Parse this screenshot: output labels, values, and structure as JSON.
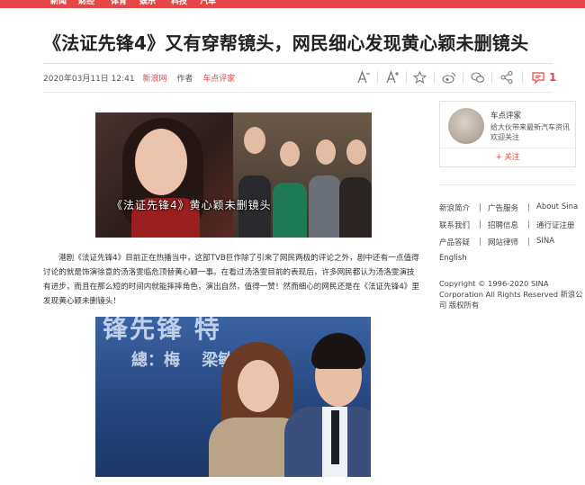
{
  "nav": {
    "items": [
      "新闻",
      "财经",
      "体育",
      "娱乐",
      "科技",
      "汽车"
    ]
  },
  "article": {
    "title": "《法证先锋4》又有穿帮镜头，网民细心发现黄心颖未删镜头",
    "date": "2020年03月11日 12:41",
    "source": "新浪网",
    "author_label": "作者",
    "author": "车点评家",
    "comment_count": "1",
    "image1_caption": "《法证先锋4》黄心颖未删镜头",
    "paragraph": "港剧《法证先锋4》目前正在热播当中，这部TVB巨作除了引来了网民两极的评论之外，剧中还有一点值得讨论的就是饰演徐意的汤洛雯临危顶替黄心颖一事。在看过汤洛雯目前的表现后，许多网民都认为汤洛雯演技有进步，而且在那么短的时间内就能摔摔角色，演出自然，值得一赞！然而细心的网民还是在《法证先锋4》里发现黄心颖未删镜头！",
    "image2_text_top": "锋先锋 特",
    "image2_text_mid": "總：梅 　梁敏"
  },
  "tools": {
    "icons": [
      "font-decrease-icon",
      "font-increase-icon",
      "star-icon",
      "weibo-icon",
      "wechat-icon",
      "share-icon",
      "comment-icon"
    ]
  },
  "sidebar": {
    "card": {
      "name": "车点评家",
      "desc": "给大伙带来最新汽车资讯欢迎关注",
      "follow_label": "+ 关注"
    },
    "links": [
      [
        "新浪简介",
        "广告服务",
        "About Sina"
      ],
      [
        "联系我们",
        "招聘信息",
        "通行证注册"
      ],
      [
        "产品答疑",
        "网站律师",
        "SINA"
      ],
      [
        "English"
      ]
    ],
    "copyright": "Copyright © 1996-2020 SINA Corporation All Rights Reserved 新浪公司 版权所有"
  },
  "colors": {
    "accent": "#e64646"
  }
}
